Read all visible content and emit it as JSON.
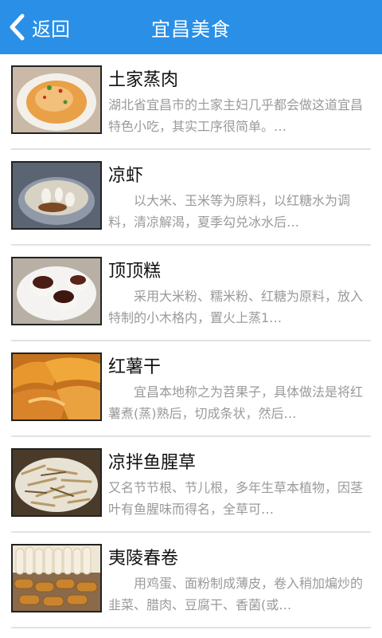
{
  "header": {
    "back_label": "返回",
    "title": "宜昌美食",
    "background": "#2a8fe6"
  },
  "items": [
    {
      "title": "土家蒸肉",
      "desc": "湖北省宜昌市的土家主妇几乎都会做这道宜昌特色小吃，其实工序很简单。…",
      "image": "steamed-pork-photo"
    },
    {
      "title": "凉虾",
      "desc": "　　以大米、玉米等为原料，以红糖水为调料，清凉解渴，夏季勾兑冰水后…",
      "image": "liang-xia-photo"
    },
    {
      "title": "顶顶糕",
      "desc": "　　采用大米粉、糯米粉、红糖为原料，放入特制的小木格内，置火上蒸1…",
      "image": "dingding-cake-photo"
    },
    {
      "title": "红薯干",
      "desc": "　　宜昌本地称之为苕果子，具体做法是将红薯煮(蒸)熟后，切成条状，然后…",
      "image": "sweet-potato-photo"
    },
    {
      "title": "凉拌鱼腥草",
      "desc": "又名节节根、节儿根，多年生草本植物，因茎叶有鱼腥味而得名，全草可…",
      "image": "houttuynia-photo"
    },
    {
      "title": "夷陵春卷",
      "desc": "　　用鸡蛋、面粉制成薄皮，卷入稍加煸炒的韭菜、腊肉、豆腐干、香菌(或…",
      "image": "spring-roll-photo"
    }
  ]
}
